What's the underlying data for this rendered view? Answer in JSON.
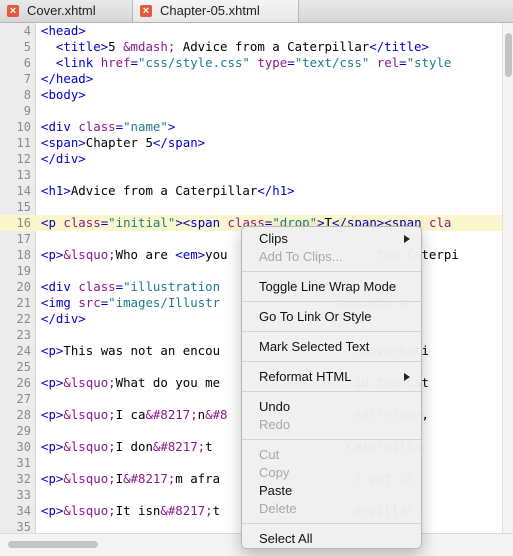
{
  "tabs": [
    {
      "label": "Cover.xhtml",
      "close_glyph": "×"
    },
    {
      "label": "Chapter-05.xhtml",
      "close_glyph": "×"
    }
  ],
  "code": {
    "lines": [
      {
        "n": "4",
        "parts": [
          [
            "tag",
            "<head>"
          ]
        ]
      },
      {
        "n": "5",
        "parts": [
          [
            "txt",
            "  "
          ],
          [
            "tag",
            "<title>"
          ],
          [
            "txt",
            "5 "
          ],
          [
            "ent",
            "&mdash;"
          ],
          [
            "txt",
            " Advice from a Caterpillar"
          ],
          [
            "tag",
            "</title>"
          ]
        ]
      },
      {
        "n": "6",
        "parts": [
          [
            "txt",
            "  "
          ],
          [
            "tag",
            "<link "
          ],
          [
            "attr",
            "href"
          ],
          [
            "tag",
            "="
          ],
          [
            "val",
            "\"css/style.css\""
          ],
          [
            "txt",
            " "
          ],
          [
            "attr",
            "type"
          ],
          [
            "tag",
            "="
          ],
          [
            "val",
            "\"text/css\""
          ],
          [
            "txt",
            " "
          ],
          [
            "attr",
            "rel"
          ],
          [
            "tag",
            "="
          ],
          [
            "val",
            "\"style"
          ]
        ]
      },
      {
        "n": "7",
        "parts": [
          [
            "tag",
            "</head>"
          ]
        ]
      },
      {
        "n": "8",
        "parts": [
          [
            "tag",
            "<body>"
          ]
        ]
      },
      {
        "n": "9",
        "parts": []
      },
      {
        "n": "10",
        "parts": [
          [
            "tag",
            "<div "
          ],
          [
            "attr",
            "class"
          ],
          [
            "tag",
            "="
          ],
          [
            "val",
            "\"name\""
          ],
          [
            "tag",
            ">"
          ]
        ]
      },
      {
        "n": "11",
        "parts": [
          [
            "tag",
            "<span>"
          ],
          [
            "txt",
            "Chapter 5"
          ],
          [
            "tag",
            "</span>"
          ]
        ]
      },
      {
        "n": "12",
        "parts": [
          [
            "tag",
            "</div>"
          ]
        ]
      },
      {
        "n": "13",
        "parts": []
      },
      {
        "n": "14",
        "parts": [
          [
            "tag",
            "<h1>"
          ],
          [
            "txt",
            "Advice from a Caterpillar"
          ],
          [
            "tag",
            "</h1>"
          ]
        ]
      },
      {
        "n": "15",
        "parts": []
      },
      {
        "n": "16",
        "parts": [
          [
            "tag",
            "<p "
          ],
          [
            "attr",
            "class"
          ],
          [
            "tag",
            "="
          ],
          [
            "val",
            "\"initial\""
          ],
          [
            "tag",
            "><span "
          ],
          [
            "attr",
            "class"
          ],
          [
            "tag",
            "="
          ],
          [
            "val",
            "\"drop\""
          ],
          [
            "tag",
            ">"
          ],
          [
            "txt",
            "T"
          ],
          [
            "tag",
            "</span><span "
          ],
          [
            "attr",
            "cla"
          ]
        ]
      },
      {
        "n": "17",
        "parts": []
      },
      {
        "n": "18",
        "parts": [
          [
            "tag",
            "<p>"
          ],
          [
            "ent",
            "&lsquo;"
          ],
          [
            "txt",
            "Who are "
          ],
          [
            "tag",
            "<em>"
          ],
          [
            "txt",
            "you                    the Caterpi"
          ]
        ]
      },
      {
        "n": "19",
        "parts": []
      },
      {
        "n": "20",
        "parts": [
          [
            "tag",
            "<div "
          ],
          [
            "attr",
            "class"
          ],
          [
            "tag",
            "="
          ],
          [
            "val",
            "\"illustration"
          ]
        ]
      },
      {
        "n": "21",
        "parts": [
          [
            "tag",
            "<img "
          ],
          [
            "attr",
            "src"
          ],
          [
            "tag",
            "="
          ],
          [
            "val",
            "\"images/Illustr"
          ],
          [
            "txt",
            "               "
          ],
          [
            "ent",
            "squo;"
          ],
          [
            "txt",
            "Who a"
          ]
        ]
      },
      {
        "n": "22",
        "parts": [
          [
            "tag",
            "</div>"
          ]
        ]
      },
      {
        "n": "23",
        "parts": []
      },
      {
        "n": "24",
        "parts": [
          [
            "tag",
            "<p>"
          ],
          [
            "txt",
            "This was not an encou                  conversati"
          ]
        ]
      },
      {
        "n": "25",
        "parts": []
      },
      {
        "n": "26",
        "parts": [
          [
            "tag",
            "<p>"
          ],
          [
            "ent",
            "&lsquo;"
          ],
          [
            "txt",
            "What do you me                  id the Cat"
          ]
        ]
      },
      {
        "n": "27",
        "parts": []
      },
      {
        "n": "28",
        "parts": [
          [
            "tag",
            "<p>"
          ],
          [
            "ent",
            "&lsquo;"
          ],
          [
            "txt",
            "I ca"
          ],
          [
            "ent",
            "&#8217;"
          ],
          [
            "txt",
            "n"
          ],
          [
            "ent",
            "&#8"
          ],
          [
            "txt",
            "                 self"
          ],
          [
            "tag",
            "</em>"
          ],
          [
            "txt",
            ","
          ]
        ]
      },
      {
        "n": "29",
        "parts": []
      },
      {
        "n": "30",
        "parts": [
          [
            "tag",
            "<p>"
          ],
          [
            "ent",
            "&lsquo;"
          ],
          [
            "txt",
            "I don"
          ],
          [
            "ent",
            "&#8217;"
          ],
          [
            "txt",
            "t                  Caterpilla"
          ]
        ]
      },
      {
        "n": "31",
        "parts": []
      },
      {
        "n": "32",
        "parts": [
          [
            "tag",
            "<p>"
          ],
          [
            "ent",
            "&lsquo;"
          ],
          [
            "txt",
            "I"
          ],
          [
            "ent",
            "&#8217;"
          ],
          [
            "txt",
            "m afra                  t put it"
          ]
        ]
      },
      {
        "n": "33",
        "parts": []
      },
      {
        "n": "34",
        "parts": [
          [
            "tag",
            "<p>"
          ],
          [
            "ent",
            "&lsquo;"
          ],
          [
            "txt",
            "It isn"
          ],
          [
            "ent",
            "&#8217;"
          ],
          [
            "txt",
            "t                  erpillar."
          ]
        ]
      },
      {
        "n": "35",
        "parts": []
      }
    ]
  },
  "context_menu": {
    "items": [
      {
        "label": "Clips",
        "enabled": true,
        "submenu": true
      },
      {
        "label": "Add To Clips...",
        "enabled": false,
        "submenu": false
      },
      {
        "sep": true
      },
      {
        "label": "Toggle Line Wrap Mode",
        "enabled": true,
        "submenu": false
      },
      {
        "sep": true
      },
      {
        "label": "Go To Link Or Style",
        "enabled": true,
        "submenu": false
      },
      {
        "sep": true
      },
      {
        "label": "Mark Selected Text",
        "enabled": true,
        "submenu": false
      },
      {
        "sep": true
      },
      {
        "label": "Reformat HTML",
        "enabled": true,
        "submenu": true
      },
      {
        "sep": true
      },
      {
        "label": "Undo",
        "enabled": true,
        "submenu": false
      },
      {
        "label": "Redo",
        "enabled": false,
        "submenu": false
      },
      {
        "sep": true
      },
      {
        "label": "Cut",
        "enabled": false,
        "submenu": false
      },
      {
        "label": "Copy",
        "enabled": false,
        "submenu": false
      },
      {
        "label": "Paste",
        "enabled": true,
        "submenu": false
      },
      {
        "label": "Delete",
        "enabled": false,
        "submenu": false
      },
      {
        "sep": true
      },
      {
        "label": "Select All",
        "enabled": true,
        "submenu": false
      }
    ]
  }
}
